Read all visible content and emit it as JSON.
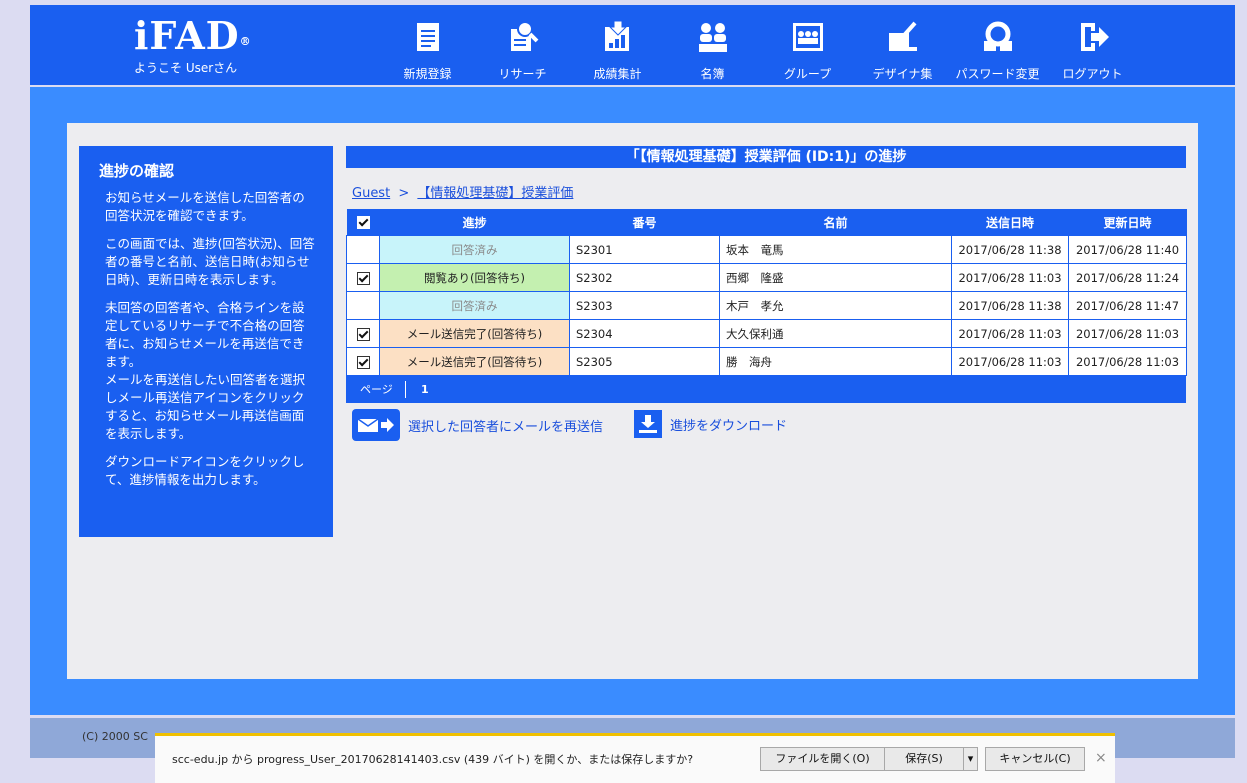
{
  "header": {
    "logo": "iFAD",
    "logo_mark": "®",
    "welcome": "ようこそ Userさん",
    "nav": [
      {
        "label": "新規登録",
        "icon": "document-icon"
      },
      {
        "label": "リサーチ",
        "icon": "research-icon"
      },
      {
        "label": "成績集計",
        "icon": "grade-tally-icon"
      },
      {
        "label": "名簿",
        "icon": "roster-icon"
      },
      {
        "label": "グループ",
        "icon": "group-icon"
      },
      {
        "label": "デザイナ集",
        "icon": "designer-icon"
      },
      {
        "label": "パスワード変更",
        "icon": "password-icon"
      },
      {
        "label": "ログアウト",
        "icon": "logout-icon"
      }
    ]
  },
  "side": {
    "title": "進捗の確認",
    "paragraphs": [
      "お知らせメールを送信した回答者の回答状況を確認できます。",
      "この画面では、進捗(回答状況)、回答者の番号と名前、送信日時(お知らせ日時)、更新日時を表示します。",
      "未回答の回答者や、合格ラインを設定しているリサーチで不合格の回答者に、お知らせメールを再送信できます。",
      "メールを再送信したい回答者を選択しメール再送信アイコンをクリックすると、お知らせメール再送信画面を表示します。",
      "ダウンロードアイコンをクリックして、進捗情報を出力します。"
    ]
  },
  "main": {
    "title": "「【情報処理基礎】授業評価 (ID:1)」の進捗",
    "breadcrumb": {
      "home": "Guest",
      "separator": ">",
      "current": "【情報処理基礎】授業評価"
    },
    "columns": [
      "進捗",
      "番号",
      "名前",
      "送信日時",
      "更新日時"
    ],
    "header_checked": true,
    "rows": [
      {
        "checked": false,
        "status": "回答済み",
        "status_color": "#c8f4fa",
        "status_text_color": "#8a8a8a",
        "number": "S2301",
        "name": "坂本　竜馬",
        "sent": "2017/06/28 11:38",
        "updated": "2017/06/28 11:40"
      },
      {
        "checked": true,
        "status": "閲覧あり(回答待ち)",
        "status_color": "#c4f0b0",
        "status_text_color": "#222222",
        "number": "S2302",
        "name": "西郷　隆盛",
        "sent": "2017/06/28 11:03",
        "updated": "2017/06/28 11:24"
      },
      {
        "checked": false,
        "status": "回答済み",
        "status_color": "#c8f4fa",
        "status_text_color": "#8a8a8a",
        "number": "S2303",
        "name": "木戸　孝允",
        "sent": "2017/06/28 11:38",
        "updated": "2017/06/28 11:47"
      },
      {
        "checked": true,
        "status": "メール送信完了(回答待ち)",
        "status_color": "#fce0c4",
        "status_text_color": "#222222",
        "number": "S2304",
        "name": "大久保利通",
        "sent": "2017/06/28 11:03",
        "updated": "2017/06/28 11:03"
      },
      {
        "checked": true,
        "status": "メール送信完了(回答待ち)",
        "status_color": "#fce0c4",
        "status_text_color": "#222222",
        "number": "S2305",
        "name": "勝　海舟",
        "sent": "2017/06/28 11:03",
        "updated": "2017/06/28 11:03"
      }
    ],
    "pager": {
      "label": "ページ",
      "current": "1"
    },
    "resend_label": "選択した回答者にメールを再送信",
    "download_label": "進捗をダウンロード"
  },
  "footer": {
    "copyright": "(C) 2000 SC"
  },
  "download_bar": {
    "message": "scc-edu.jp から progress_User_20170628141403.csv (439 バイト) を開くか、または保存しますか?",
    "open": "ファイルを開く(O)",
    "save": "保存(S)",
    "dropdown": "▾",
    "cancel": "キャンセル(C)",
    "close": "×"
  },
  "colors": {
    "accent": "#1a5ff0",
    "frame": "#3a8cff",
    "link": "#1a4fdc"
  }
}
